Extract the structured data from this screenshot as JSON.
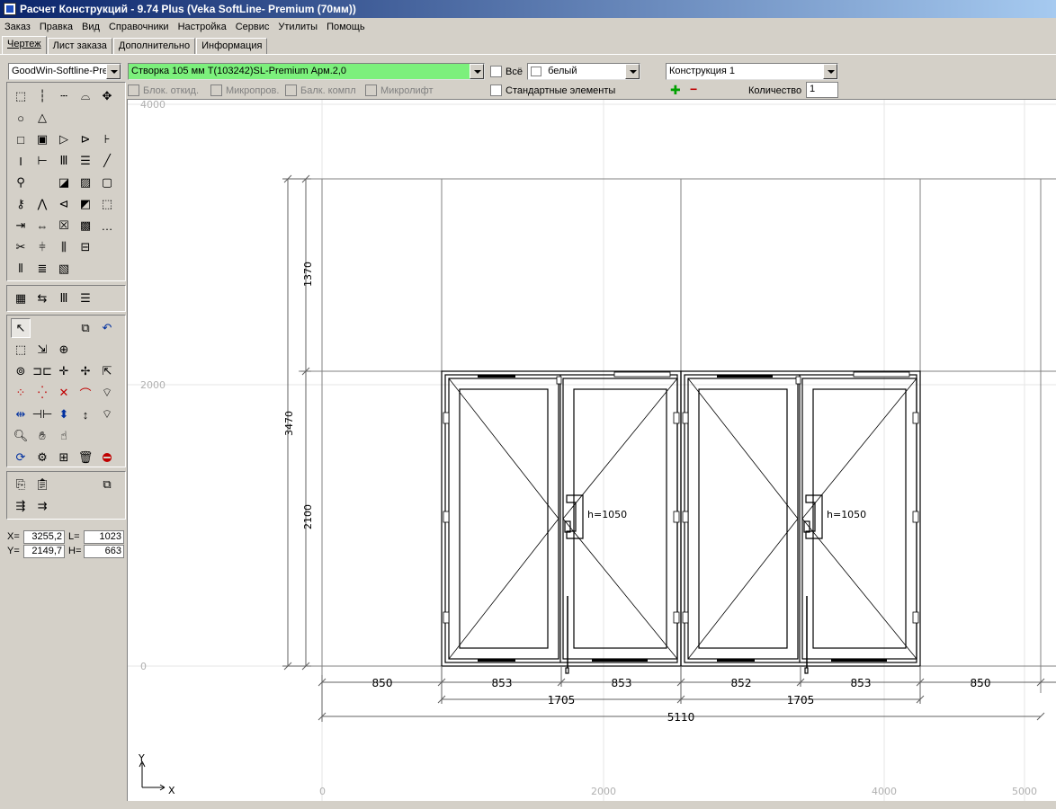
{
  "window": {
    "title": "Расчет Конструкций - 9.74 Plus (Veka SoftLine- Premium (70мм))"
  },
  "menu": [
    "Заказ",
    "Правка",
    "Вид",
    "Справочники",
    "Настройка",
    "Сервис",
    "Утилиты",
    "Помощь"
  ],
  "tabs": [
    "Чертеж",
    "Лист заказа",
    "Дополнительно",
    "Информация"
  ],
  "toolbar": {
    "profile_combo": "GoodWin-Softline-Prem",
    "element_combo": "Створка  105 мм T(103242)SL-Premium Арм.2,0",
    "element_combo_color": "#7cf07c",
    "all_label": "Всё",
    "color_combo": "белый",
    "construction_combo": "Конструкция 1",
    "standard_elements_label": "Стандартные элементы",
    "quantity_label": "Количество",
    "quantity_value": "1",
    "disabled_options": [
      "Блок. откид.",
      "Микропров.",
      "Балк. компл",
      "Микролифт"
    ]
  },
  "coords": {
    "x_label": "X=",
    "x_value": "3255,2",
    "y_label": "Y=",
    "y_value": "2149,7",
    "l_label": "L=",
    "l_value": "1023",
    "h_label": "H=",
    "h_value": "663"
  },
  "drawing": {
    "grid_labels_y": [
      "4000",
      "2000",
      "0"
    ],
    "grid_labels_x": [
      "0",
      "2000",
      "4000",
      "5000"
    ],
    "vertical_dims": [
      "1370",
      "3470",
      "2100"
    ],
    "bottom_dims_row1": [
      "850",
      "853",
      "853",
      "852",
      "853",
      "850"
    ],
    "bottom_dims_row2": [
      "1705",
      "1705"
    ],
    "bottom_dims_row3": [
      "5110"
    ],
    "handle_labels": [
      "h=1050",
      "h=1050"
    ],
    "axis_y": "Y",
    "axis_x": "X"
  }
}
